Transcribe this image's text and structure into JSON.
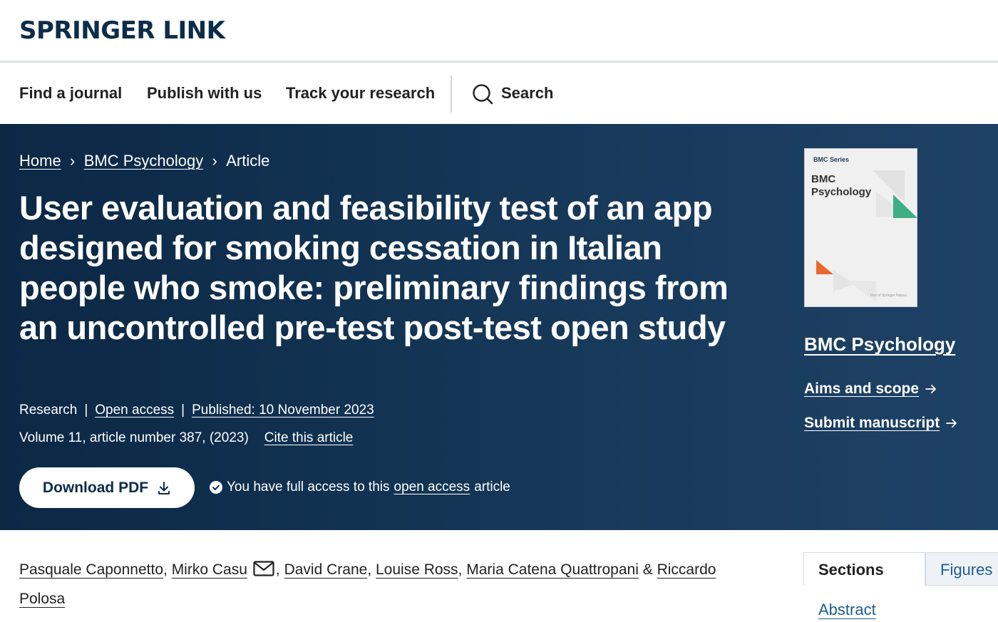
{
  "header": {
    "logo": "SPRINGER LINK"
  },
  "nav": {
    "find_journal": "Find a journal",
    "publish": "Publish with us",
    "track": "Track your research",
    "search": "Search"
  },
  "breadcrumb": {
    "home": "Home",
    "journal": "BMC Psychology",
    "current": "Article",
    "separator": "›"
  },
  "article": {
    "title": "User evaluation and feasibility test of an app designed for smoking cessation in Italian people who smoke: preliminary findings from an uncontrolled pre-test post-test open study",
    "type": "Research",
    "access": "Open access",
    "published": "Published: 10 November 2023",
    "volume": "Volume 11, article number 387, (2023)",
    "cite": "Cite this article",
    "pipe": "|"
  },
  "download": {
    "label": "Download PDF"
  },
  "access_note": {
    "before": "You have full access to this",
    "link": "open access",
    "after": "article"
  },
  "sidebar": {
    "cover": {
      "series": "BMC Series",
      "name_line1": "BMC",
      "name_line2": "Psychology",
      "footer": "Part of Springer Nature"
    },
    "journal_name": "BMC Psychology",
    "aims": "Aims and scope",
    "submit": "Submit manuscript"
  },
  "authors": {
    "a1": "Pasquale Caponnetto",
    "a2": "Mirko Casu",
    "a3": "David Crane",
    "a4": "Louise Ross",
    "a5": "Maria Catena Quattropani",
    "a6": "Riccardo Polosa",
    "comma": ",",
    "amp": "&"
  },
  "tabs": {
    "sections": "Sections",
    "figures": "Figures"
  },
  "toc": {
    "abstract": "Abstract"
  },
  "colors": {
    "hero_bg": "#0b2845",
    "brand": "#0c2d4a",
    "link_blue": "#1d5d90",
    "cover_green": "#3fae86",
    "cover_orange": "#e8692e"
  }
}
